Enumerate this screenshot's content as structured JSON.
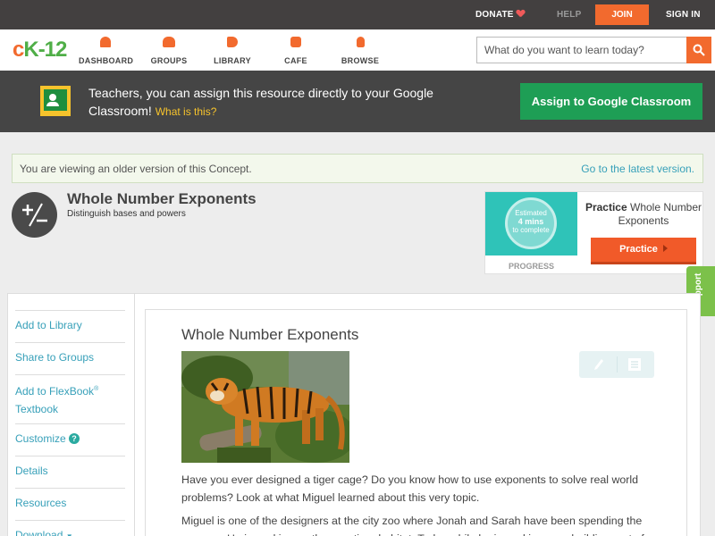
{
  "topbar": {
    "donate": "DONATE",
    "help": "HELP",
    "join": "JOIN",
    "signin": "SIGN IN"
  },
  "logo": {
    "c": "c",
    "k": "K-12"
  },
  "nav": {
    "items": [
      {
        "label": "DASHBOARD",
        "icon": "dashboard-icon"
      },
      {
        "label": "GROUPS",
        "icon": "groups-icon"
      },
      {
        "label": "LIBRARY",
        "icon": "library-icon"
      },
      {
        "label": "CAFE",
        "icon": "cafe-icon"
      },
      {
        "label": "BROWSE",
        "icon": "browse-icon"
      }
    ],
    "search_placeholder": "What do you want to learn today?"
  },
  "banner": {
    "message": "Teachers, you can assign this resource directly to your Google Classroom!",
    "what_is_this": "What is this?",
    "assign_button": "Assign to Google Classroom"
  },
  "notice": {
    "text": "You are viewing an older version of this Concept.",
    "link": "Go to the latest version."
  },
  "concept": {
    "title": "Whole Number Exponents",
    "subtitle": "Distinguish bases and powers"
  },
  "practice": {
    "estimated_l1": "Estimated",
    "estimated_l2": "4 mins",
    "estimated_l3": "to complete",
    "progress_label": "PROGRESS",
    "title_bold": "Practice",
    "title_rest": "Whole Number Exponents",
    "button": "Practice"
  },
  "support": "Support",
  "sidebar": {
    "add_library": "Add to Library",
    "share_groups": "Share to Groups",
    "add_flexbook": "Add to FlexBook",
    "flexbook_reg": "®",
    "flexbook_textbook": "Textbook",
    "customize": "Customize",
    "customize_help": "?",
    "details": "Details",
    "resources": "Resources",
    "download": "Download",
    "download_caret": "▼"
  },
  "main": {
    "title": "Whole Number Exponents",
    "para1": "Have you ever designed a tiger cage? Do you know how to use exponents to solve real world problems? Look at what Miguel learned about this very topic.",
    "para2": "Miguel is one of the designers at the city zoo where Jonah and Sarah have been spending the summer. He is working on the new tiger habitat. Today while he is working on rebuilding part of"
  },
  "colors": {
    "accent_orange": "#f26a2e",
    "link_teal": "#37a0b9",
    "google_green": "#1e9e55",
    "support_green": "#7cc14a"
  }
}
